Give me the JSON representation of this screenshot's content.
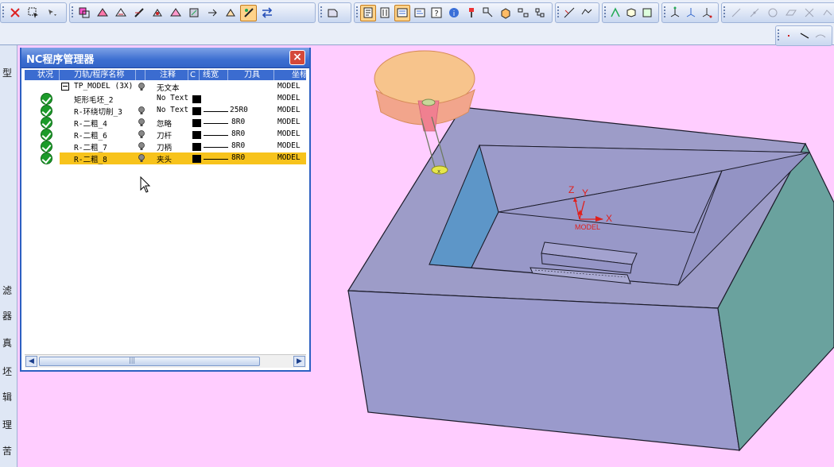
{
  "nc_panel": {
    "title": "NC程序管理器",
    "close_label": "×",
    "columns": [
      "状况",
      "刀轨/程序名称",
      "",
      "注释",
      "C",
      "线宽",
      "刀具",
      "坐标"
    ],
    "rows": [
      {
        "name": "TP_MODEL (3X)",
        "comment": "无文本",
        "tool": "",
        "coord": "MODEL",
        "has_check": false,
        "has_bulb": true,
        "has_swatch": false,
        "selected": false
      },
      {
        "name": "矩形毛坯_2",
        "comment": "No Text",
        "tool": "",
        "coord": "MODEL",
        "has_check": true,
        "has_bulb": false,
        "has_swatch": true,
        "selected": false
      },
      {
        "name": "R-环绕切削_3",
        "comment": "No Text",
        "tool": "25R0",
        "coord": "MODEL",
        "has_check": true,
        "has_bulb": true,
        "has_swatch": true,
        "selected": false
      },
      {
        "name": "R-二粗_4",
        "comment": "忽略",
        "tool": "8R0",
        "coord": "MODEL",
        "has_check": true,
        "has_bulb": true,
        "has_swatch": true,
        "selected": false
      },
      {
        "name": "R-二粗_6",
        "comment": "刀杆",
        "tool": "8R0",
        "coord": "MODEL",
        "has_check": true,
        "has_bulb": true,
        "has_swatch": true,
        "selected": false
      },
      {
        "name": "R-二粗_7",
        "comment": "刀柄",
        "tool": "8R0",
        "coord": "MODEL",
        "has_check": true,
        "has_bulb": true,
        "has_swatch": true,
        "selected": false
      },
      {
        "name": "R-二粗_8",
        "comment": "夹头",
        "tool": "8R0",
        "coord": "MODEL",
        "has_check": true,
        "has_bulb": true,
        "has_swatch": true,
        "selected": true
      }
    ],
    "scroll_grip": "|||"
  },
  "left_strip": {
    "chars": [
      "型",
      "滤",
      "器",
      "真",
      "坯",
      "辑",
      "理",
      "苦"
    ]
  },
  "viewport": {
    "axis_z": "Z",
    "axis_y": "Y",
    "axis_x": "X",
    "csys_label": "MODEL"
  },
  "colors": {
    "background": "#ffcdff",
    "part_top": "#9d9cc8",
    "part_front": "#9a9acc",
    "part_right": "#6aa29e",
    "pocket_left_wall": "#5d96c8",
    "tool_holder": "#f7c48c",
    "selection": "#f7c31c",
    "titlebar": "#3d6fd1",
    "axis": "#e0201c"
  },
  "toolbar": {
    "row1_icons": [
      "select-icon",
      "filter-icon",
      "group-op-1-icon",
      "group-op-2-icon",
      "group-op-3-icon",
      "group-op-4-icon",
      "group-op-5-icon",
      "group-op-6-icon",
      "group-op-7-icon",
      "group-op-8-icon",
      "group-op-9-icon",
      "group-op-10-icon",
      "generate-icon",
      "postprocess-icon",
      "program-view-icon",
      "tool-view-icon",
      "geometry-view-icon",
      "method-view-icon",
      "help-icon",
      "info-icon",
      "tool-icon",
      "transform-icon",
      "object-icon",
      "list-icon",
      "output-icon",
      "verify-icon",
      "replay-icon",
      "flip-icon",
      "box-icon",
      "tag-icon",
      "csys-1-icon",
      "csys-2-icon",
      "csys-3-icon",
      "line-icon",
      "arc-icon",
      "circle-icon",
      "plane-icon",
      "intersect-icon",
      "trim-icon"
    ],
    "row2_icons": [
      "point-icon",
      "slash-icon",
      "curve-icon"
    ]
  }
}
